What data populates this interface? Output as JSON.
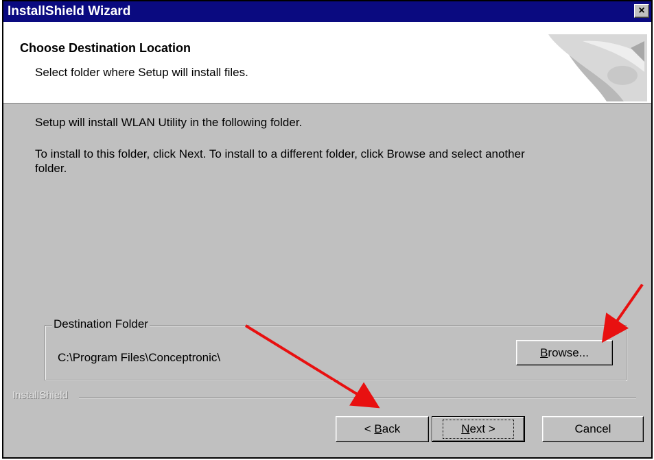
{
  "window": {
    "title": "InstallShield Wizard",
    "close_symbol": "×"
  },
  "header": {
    "title": "Choose Destination Location",
    "subtitle": "Select folder where Setup will install files."
  },
  "content": {
    "line1": "Setup will install WLAN Utility in the following folder.",
    "line2a": "To install to this folder, click Next. To install to a different folder, click Browse and select another",
    "line2b": "folder."
  },
  "destination": {
    "legend": "Destination Folder",
    "path": "C:\\Program Files\\Conceptronic\\",
    "browse_label_pre": "B",
    "browse_label_rest": "rowse..."
  },
  "footer": {
    "brand": "InstallShield",
    "back_label": {
      "prefix": "< ",
      "mnemonic": "B",
      "rest": "ack"
    },
    "next_label": {
      "mnemonic": "N",
      "rest": "ext >"
    },
    "cancel_label": "Cancel"
  },
  "annotations": {
    "arrow_color": "#e81010"
  },
  "colors": {
    "titlebar": "#0a0a80",
    "dialog_bg": "#c0c0c0",
    "header_bg": "#ffffff"
  }
}
